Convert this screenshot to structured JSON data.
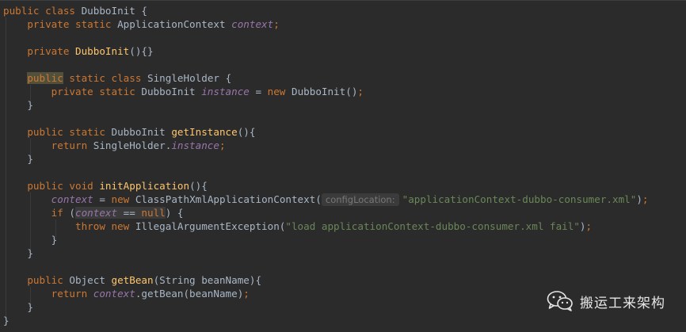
{
  "editor": {
    "lines": [
      [
        {
          "t": "public class ",
          "c": "kw"
        },
        {
          "t": "DubboInit ",
          "c": "cls"
        },
        {
          "t": "{",
          "c": "pl"
        }
      ],
      [
        {
          "t": "    private static ",
          "c": "kw"
        },
        {
          "t": "ApplicationContext ",
          "c": "cls"
        },
        {
          "t": "context",
          "c": "sf"
        },
        {
          "t": ";",
          "c": "kw"
        }
      ],
      [],
      [
        {
          "t": "    private ",
          "c": "kw"
        },
        {
          "t": "DubboInit",
          "c": "fn"
        },
        {
          "t": "(){}",
          "c": "pl"
        }
      ],
      [],
      [
        {
          "t": "    ",
          "c": "pl"
        },
        {
          "t": "public",
          "c": "kw",
          "hl": "public"
        },
        {
          "t": " static class ",
          "c": "kw"
        },
        {
          "t": "SingleHolder ",
          "c": "cls"
        },
        {
          "t": "{",
          "c": "pl"
        }
      ],
      [
        {
          "t": "        private static ",
          "c": "kw"
        },
        {
          "t": "DubboInit ",
          "c": "cls"
        },
        {
          "t": "instance",
          "c": "sf"
        },
        {
          "t": " = ",
          "c": "pl"
        },
        {
          "t": "new ",
          "c": "kw"
        },
        {
          "t": "DubboInit",
          "c": "cls"
        },
        {
          "t": "()",
          "c": "pl"
        },
        {
          "t": ";",
          "c": "kw"
        }
      ],
      [
        {
          "t": "    }",
          "c": "pl"
        }
      ],
      [],
      [
        {
          "t": "    public static ",
          "c": "kw"
        },
        {
          "t": "DubboInit ",
          "c": "cls"
        },
        {
          "t": "getInstance",
          "c": "fn"
        },
        {
          "t": "(){",
          "c": "pl"
        }
      ],
      [
        {
          "t": "        return ",
          "c": "kw"
        },
        {
          "t": "SingleHolder.",
          "c": "cls"
        },
        {
          "t": "instance",
          "c": "sf"
        },
        {
          "t": ";",
          "c": "kw"
        }
      ],
      [
        {
          "t": "    }",
          "c": "pl"
        }
      ],
      [],
      [
        {
          "t": "    public void ",
          "c": "kw"
        },
        {
          "t": "initApplication",
          "c": "fn"
        },
        {
          "t": "(){",
          "c": "pl"
        }
      ],
      [
        {
          "t": "        ",
          "c": "pl"
        },
        {
          "t": "context",
          "c": "sf"
        },
        {
          "t": " = ",
          "c": "pl"
        },
        {
          "t": "new ",
          "c": "kw"
        },
        {
          "t": "ClassPathXmlApplicationContext(",
          "c": "cls"
        },
        {
          "t": "configLocation:",
          "c": "hint"
        },
        {
          "t": "\"applicationContext-dubbo-consumer.xml\"",
          "c": "st"
        },
        {
          "t": ")",
          "c": "pl"
        },
        {
          "t": ";",
          "c": "kw"
        }
      ],
      [
        {
          "t": "        if ",
          "c": "kw"
        },
        {
          "t": "(",
          "c": "pl"
        },
        {
          "t": "context",
          "c": "sf",
          "hl": "cond"
        },
        {
          "t": " == ",
          "c": "pl",
          "hl": "cond"
        },
        {
          "t": "null",
          "c": "kw",
          "hl": "cond"
        },
        {
          "t": ") {",
          "c": "pl"
        }
      ],
      [
        {
          "t": "            throw new ",
          "c": "kw"
        },
        {
          "t": "IllegalArgumentException(",
          "c": "cls"
        },
        {
          "t": "\"load applicationContext-dubbo-consumer.xml fail\"",
          "c": "st"
        },
        {
          "t": ")",
          "c": "pl"
        },
        {
          "t": ";",
          "c": "kw"
        }
      ],
      [
        {
          "t": "        }",
          "c": "pl"
        }
      ],
      [
        {
          "t": "    }",
          "c": "pl"
        }
      ],
      [],
      [
        {
          "t": "    public ",
          "c": "kw"
        },
        {
          "t": "Object ",
          "c": "cls"
        },
        {
          "t": "getBean",
          "c": "fn"
        },
        {
          "t": "(String beanName){",
          "c": "pl"
        }
      ],
      [
        {
          "t": "        return ",
          "c": "kw"
        },
        {
          "t": "context",
          "c": "sf"
        },
        {
          "t": ".getBean(beanName)",
          "c": "pl"
        },
        {
          "t": ";",
          "c": "kw"
        }
      ],
      [
        {
          "t": "    }",
          "c": "pl"
        }
      ],
      [
        {
          "t": "}",
          "c": "pl"
        }
      ]
    ]
  },
  "watermark": {
    "text": "搬运工来架构",
    "icon": "wechat-icon"
  },
  "colors": {
    "background": "#2b2b2b",
    "keyword": "#cc7832",
    "method": "#ffc66d",
    "static_field": "#9876aa",
    "string": "#6a8759",
    "plain": "#a9b7c6",
    "hint": "#787878"
  }
}
